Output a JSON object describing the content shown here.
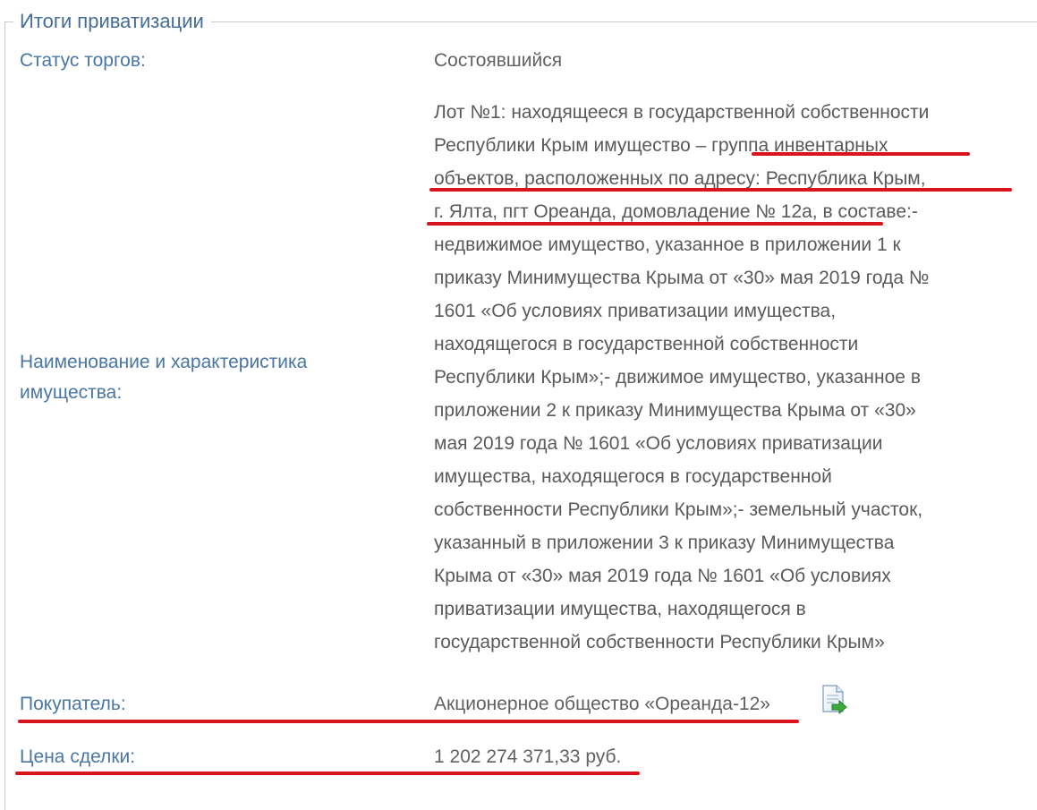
{
  "section": {
    "title": "Итоги приватизации"
  },
  "rows": {
    "status": {
      "label": "Статус торгов:",
      "value": "Состоявшийся"
    },
    "property": {
      "label_lines": [
        "Наименование и характеристика",
        "имущества:"
      ],
      "value_lines": [
        "Лот №1: находящееся в государственной собственности",
        "Республики Крым имущество – группа инвентарных",
        "объектов, расположенных по адресу: Республика Крым,",
        "г. Ялта, пгт Ореанда, домовладение № 12а, в составе:-",
        "недвижимое имущество, указанное в приложении 1 к",
        "приказу Минимущества Крыма от «30» мая 2019 года №",
        "1601 «Об условиях приватизации имущества,",
        "находящегося в государственной собственности",
        "Республики Крым»;- движимое имущество, указанное в",
        "приложении 2 к приказу Минимущества Крыма от «30»",
        "мая 2019 года № 1601 «Об условиях приватизации",
        "имущества, находящегося в государственной",
        "собственности Республики Крым»;- земельный участок,",
        "указанный в приложении 3 к приказу Минимущества",
        "Крыма от «30» мая 2019 года № 1601 «Об условиях",
        "приватизации имущества, находящегося в",
        "государственной собственности Республики Крым»"
      ]
    },
    "buyer": {
      "label": "Покупатель:",
      "value": "Акционерное общество «Ореанда-12»",
      "icon": "document-export-icon"
    },
    "price": {
      "label": "Цена сделки:",
      "value": "1 202 274 371,33 руб."
    }
  },
  "colors": {
    "label": "#4a76a5",
    "title": "#456d97",
    "value": "#5a5a5a",
    "highlight": "#d8141e",
    "border": "#c9c9c9"
  }
}
